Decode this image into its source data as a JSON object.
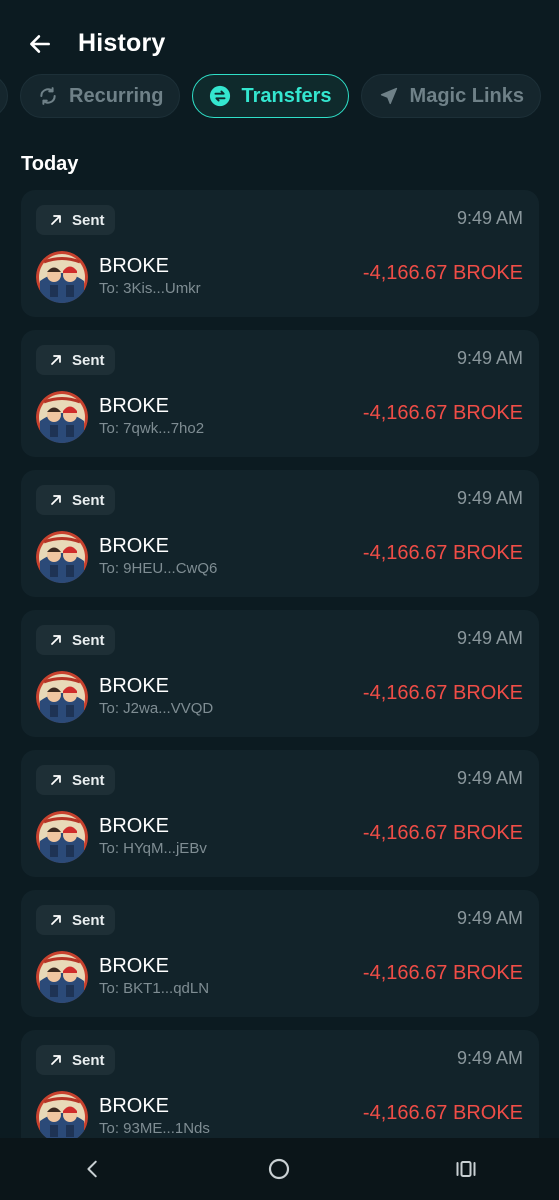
{
  "header": {
    "title": "History"
  },
  "tabs": [
    {
      "label": "",
      "icon": "partial-tab",
      "active": false
    },
    {
      "label": "Recurring",
      "icon": "recurring-icon",
      "active": false
    },
    {
      "label": "Transfers",
      "icon": "transfer-icon",
      "active": true
    },
    {
      "label": "Magic Links",
      "icon": "send-arrow-icon",
      "active": false
    }
  ],
  "section": {
    "label": "Today"
  },
  "colors": {
    "accent": "#34e6cf",
    "negative": "#ef4d47",
    "background": "#0c1b21",
    "card": "#12232a"
  },
  "transfers": [
    {
      "type": "Sent",
      "time": "9:49 AM",
      "token": "BROKE",
      "recipient": "To: 3Kis...Umkr",
      "amount": "-4,166.67 BROKE"
    },
    {
      "type": "Sent",
      "time": "9:49 AM",
      "token": "BROKE",
      "recipient": "To: 7qwk...7ho2",
      "amount": "-4,166.67 BROKE"
    },
    {
      "type": "Sent",
      "time": "9:49 AM",
      "token": "BROKE",
      "recipient": "To: 9HEU...CwQ6",
      "amount": "-4,166.67 BROKE"
    },
    {
      "type": "Sent",
      "time": "9:49 AM",
      "token": "BROKE",
      "recipient": "To: J2wa...VVQD",
      "amount": "-4,166.67 BROKE"
    },
    {
      "type": "Sent",
      "time": "9:49 AM",
      "token": "BROKE",
      "recipient": "To: HYqM...jEBv",
      "amount": "-4,166.67 BROKE"
    },
    {
      "type": "Sent",
      "time": "9:49 AM",
      "token": "BROKE",
      "recipient": "To: BKT1...qdLN",
      "amount": "-4,166.67 BROKE"
    },
    {
      "type": "Sent",
      "time": "9:49 AM",
      "token": "BROKE",
      "recipient": "To: 93ME...1Nds",
      "amount": "-4,166.67 BROKE"
    }
  ],
  "system_nav": {
    "back": "back-icon",
    "home": "home-icon",
    "recents": "recents-icon"
  }
}
